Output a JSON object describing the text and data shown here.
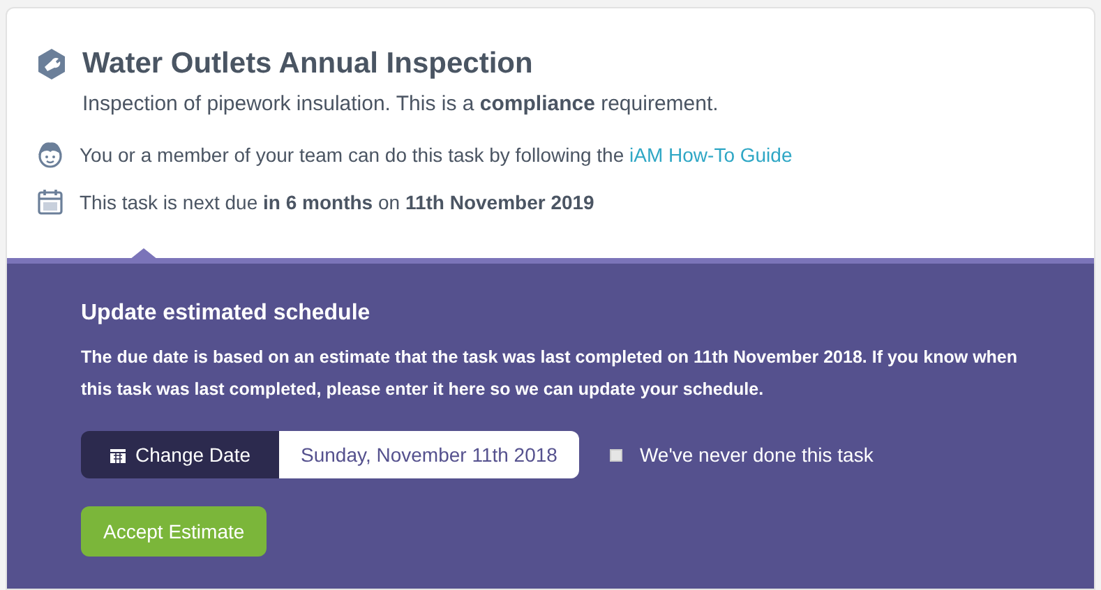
{
  "task": {
    "title": "Water Outlets Annual Inspection",
    "description": "Inspection of pipework insulation. This is a **compliance** requirement.",
    "performer": {
      "text": "You or a member of your team can do this task by following the ",
      "link": "iAM How-To Guide"
    },
    "due": "This task is next due **in 6 months** on **11th November 2019**"
  },
  "schedule_panel": {
    "heading": "Update estimated schedule",
    "body": "The due date is based on an estimate that the task was last completed on 11th November 2018. If you know when this task was last completed, please enter it here so we can update your schedule.",
    "change_date_button": "Change Date",
    "date_value": "Sunday, November 11th 2018",
    "never_done": {
      "label": "We've never done this task",
      "checked": false
    },
    "accept_button": "Accept Estimate"
  }
}
